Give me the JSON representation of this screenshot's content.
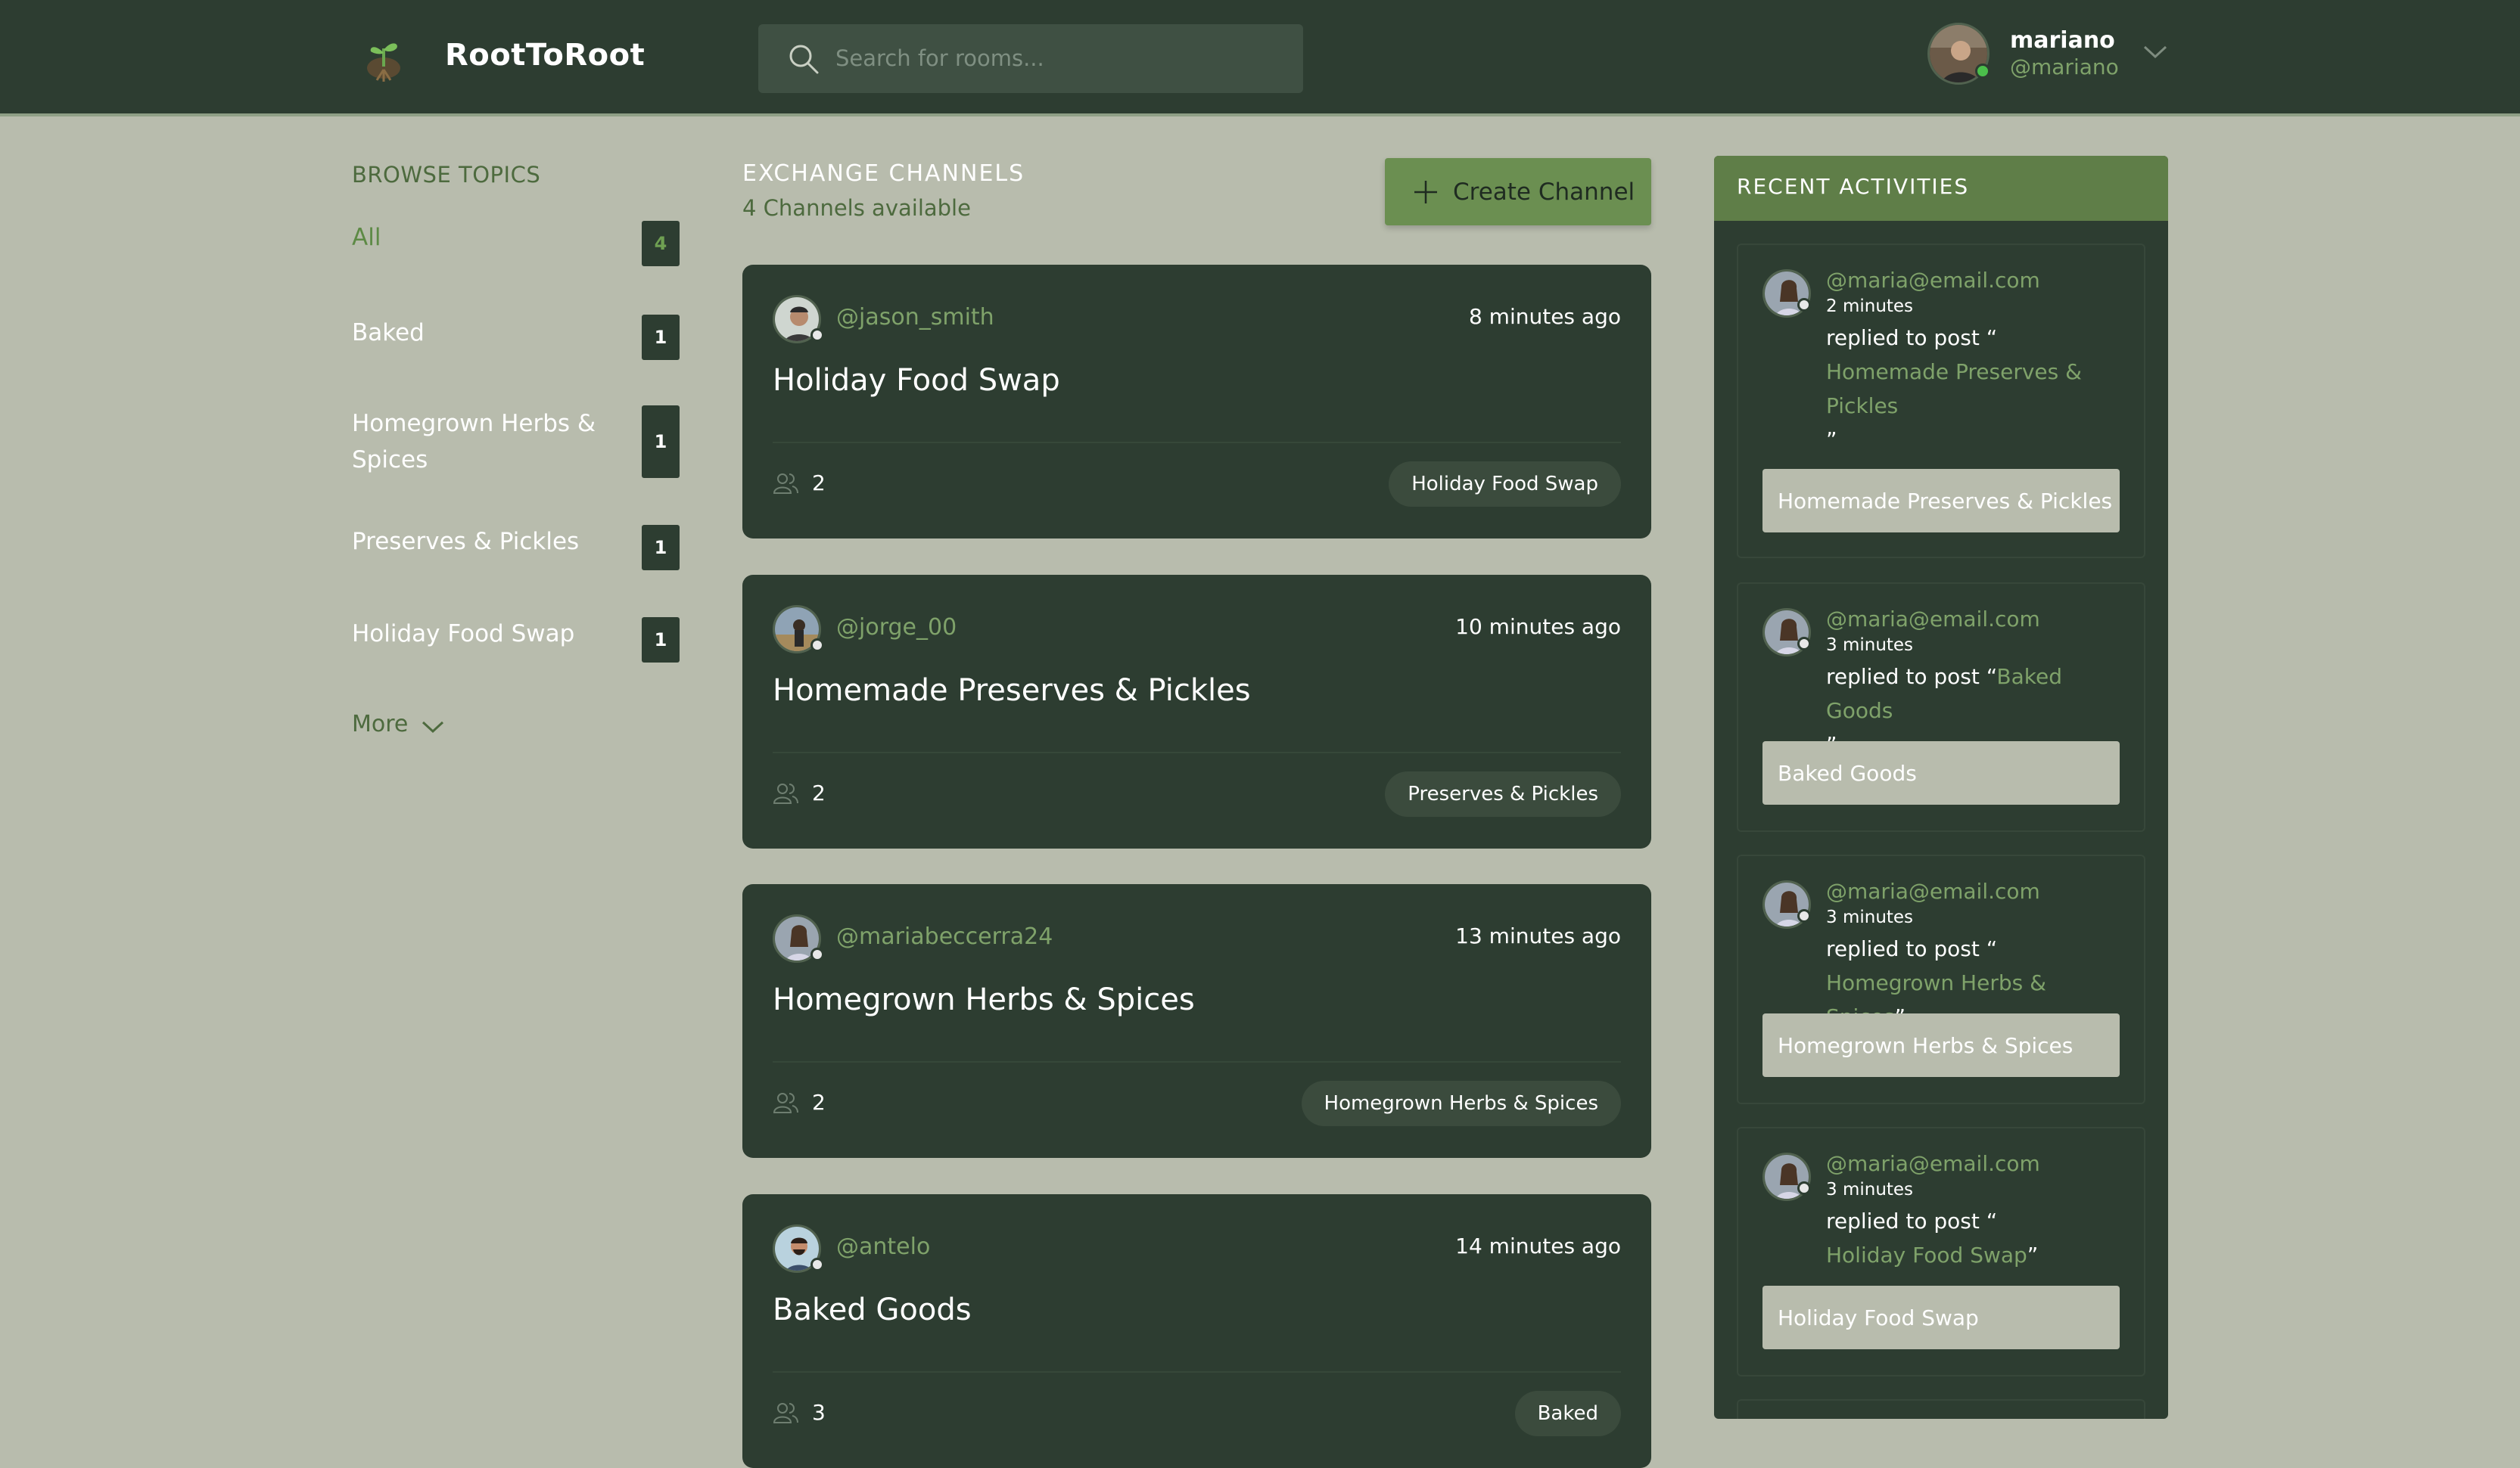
{
  "header": {
    "brand": "RootToRoot",
    "search_placeholder": "Search for rooms...",
    "user": {
      "name": "mariano",
      "handle": "@mariano"
    }
  },
  "sidebar": {
    "title": "BROWSE TOPICS",
    "topics": [
      {
        "label": "All",
        "count": "4"
      },
      {
        "label": "Baked",
        "count": "1"
      },
      {
        "label": "Homegrown Herbs & Spices",
        "count": "1"
      },
      {
        "label": "Preserves & Pickles",
        "count": "1"
      },
      {
        "label": "Holiday Food Swap",
        "count": "1"
      }
    ],
    "more_label": "More"
  },
  "main": {
    "title": "EXCHANGE CHANNELS",
    "subtitle": "4 Channels available",
    "create_label": "Create Channel",
    "channels": [
      {
        "handle": "@jason_smith",
        "time": "8 minutes ago",
        "title": "Holiday Food Swap",
        "participants": "2",
        "topic": "Holiday Food Swap"
      },
      {
        "handle": "@jorge_00",
        "time": "10 minutes ago",
        "title": "Homemade Preserves & Pickles",
        "participants": "2",
        "topic": "Preserves & Pickles"
      },
      {
        "handle": "@mariabeccerra24",
        "time": "13 minutes ago",
        "title": "Homegrown Herbs & Spices",
        "participants": "2",
        "topic": "Homegrown Herbs & Spices"
      },
      {
        "handle": "@antelo",
        "time": "14 minutes ago",
        "title": "Baked Goods",
        "participants": "3",
        "topic": "Baked"
      }
    ]
  },
  "recent": {
    "title": "RECENT ACTIVITIES",
    "items": [
      {
        "email": "@maria@email.com",
        "time": "2 minutes",
        "prefix": "replied to post “",
        "ref": "Homemade Preserves & Pickles",
        "suffix": "”",
        "box": "Homemade Preserves & Pickles"
      },
      {
        "email": "@maria@email.com",
        "time": "3 minutes",
        "prefix": "replied to post “",
        "ref": "Baked Goods",
        "suffix": "”",
        "box": "Baked Goods"
      },
      {
        "email": "@maria@email.com",
        "time": "3 minutes",
        "prefix": "replied to post “",
        "ref": "Homegrown Herbs & Spices",
        "suffix": "”",
        "box": "Homegrown Herbs & Spices"
      },
      {
        "email": "@maria@email.com",
        "time": "3 minutes",
        "prefix": "replied to post “",
        "ref": "Holiday Food Swap",
        "suffix": "”",
        "box": "Holiday Food Swap"
      }
    ]
  },
  "colors": {
    "header_bg": "#2d3d31",
    "page_bg": "#b8bcad",
    "accent_green": "#6b8f51",
    "link_green": "#7fa26a"
  }
}
